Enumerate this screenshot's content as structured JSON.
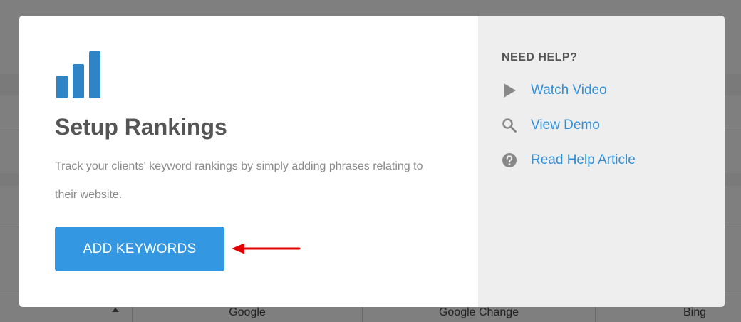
{
  "background": {
    "columns": [
      "Google",
      "Google Change",
      "Bing"
    ]
  },
  "modal": {
    "title": "Setup Rankings",
    "description": "Track your clients' keyword rankings by simply adding phrases relating to their website.",
    "add_button_label": "ADD KEYWORDS",
    "icon": "bar-chart-icon",
    "accent_color": "#3497e2",
    "arrow_color": "#e00000"
  },
  "help": {
    "title": "NEED HELP?",
    "links": [
      {
        "label": "Watch Video",
        "icon": "play-icon"
      },
      {
        "label": "View Demo",
        "icon": "search-icon"
      },
      {
        "label": "Read Help Article",
        "icon": "question-circle-icon"
      }
    ],
    "link_color": "#2d8fd8"
  }
}
